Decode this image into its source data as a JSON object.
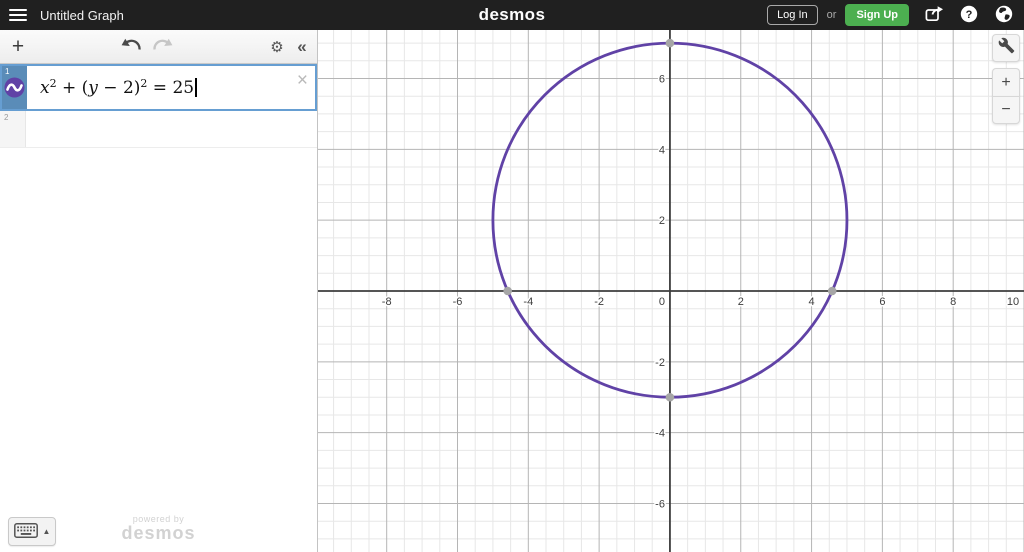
{
  "header": {
    "title": "Untitled Graph",
    "logo_text": "desmos",
    "log_in": "Log In",
    "or": "or",
    "sign_up": "Sign Up"
  },
  "toolbar": {
    "add_expression_icon": "+",
    "settings_icon": "⚙",
    "collapse_icon": "«"
  },
  "expressions": {
    "close_icon": "×",
    "rows": [
      {
        "index": "1",
        "equation_parts": {
          "t1": "x",
          "s1": "2",
          "t2": " + (",
          "t3": "y",
          "t4": " − 2)",
          "s2": "2",
          "t5": " = 25"
        }
      },
      {
        "index": "2"
      }
    ]
  },
  "keyboard_toggle": {
    "arrow": "▲"
  },
  "watermark": {
    "line1": "powered by",
    "line2": "desmos"
  },
  "side_controls": {
    "zoom_in": "+",
    "zoom_out": "−"
  },
  "colors": {
    "header_bg": "#202020",
    "selected_gutter_blue": "#5a8cb8",
    "focus_border_blue": "#669ed2",
    "brand_purple": "#6042a6",
    "signup_green": "#4caf50"
  },
  "chart_data": {
    "type": "line",
    "equation": "x² + (y − 2)² = 25",
    "curve": {
      "shape": "circle",
      "center": [
        0,
        2
      ],
      "radius": 5,
      "color": "#6042a6",
      "stroke_width": 2.8
    },
    "xlim": [
      -9.94,
      10.0
    ],
    "ylim": [
      -7.37,
      7.37
    ],
    "x_ticks": [
      -8,
      -6,
      -4,
      -2,
      0,
      2,
      4,
      6,
      8,
      10
    ],
    "y_ticks": [
      -6,
      -4,
      -2,
      2,
      4,
      6
    ],
    "major_step": 2,
    "minor_step": 0.5,
    "grid": true,
    "axis_color": "#3d3d3d",
    "grid_major_color": "#b5b5b5",
    "grid_minor_color": "#e7e7e7",
    "label_color": "#3d3d3d",
    "label_font_size": 11,
    "point_color": "#a6a6a6",
    "points_of_interest": [
      [
        0,
        7
      ],
      [
        0,
        -3
      ],
      [
        -4.5826,
        0
      ],
      [
        4.5826,
        0
      ]
    ]
  }
}
